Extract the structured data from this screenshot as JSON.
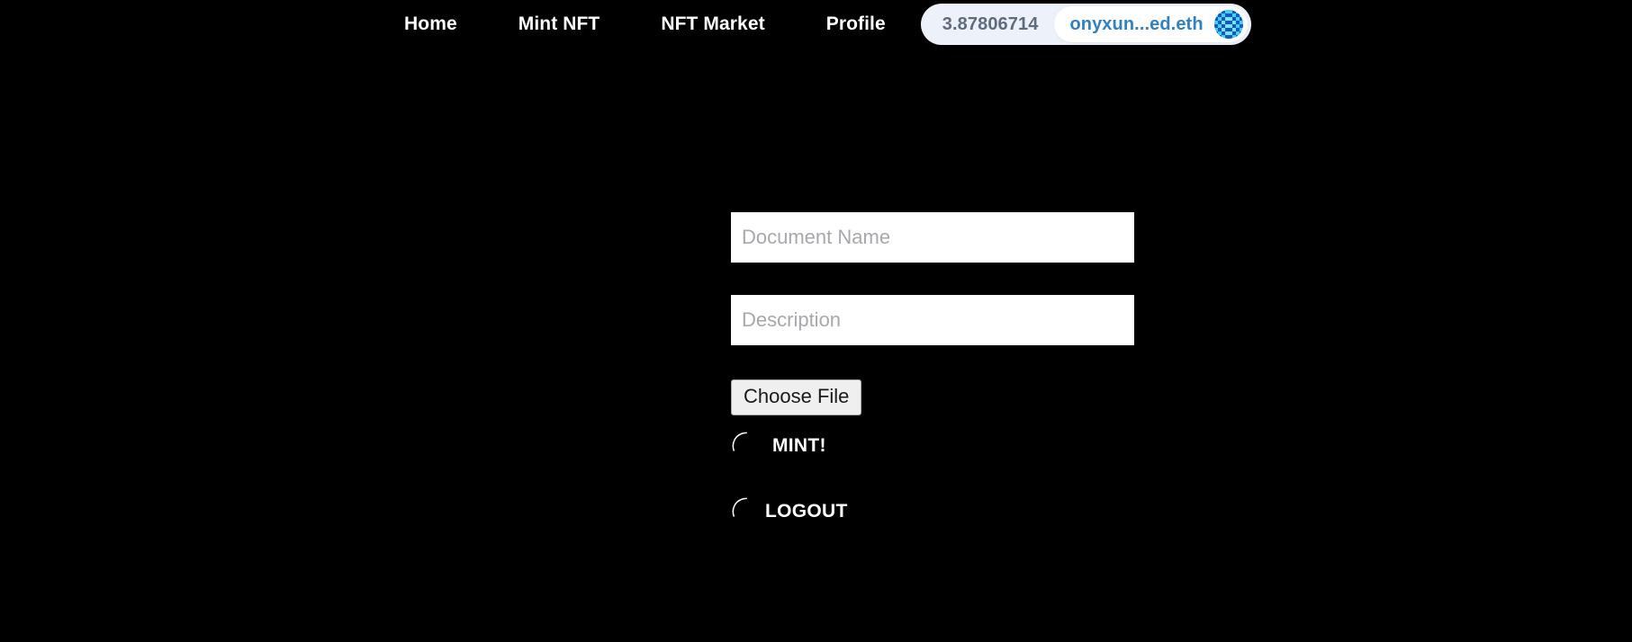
{
  "page": {
    "background_color": "#000000",
    "title": "Mint NFT"
  },
  "navbar": {
    "links": [
      {
        "label": "Home",
        "name": "nav-link-home"
      },
      {
        "label": "Mint NFT",
        "name": "nav-link-mint-nft"
      },
      {
        "label": "NFT Market",
        "name": "nav-link-nft-market"
      },
      {
        "label": "Profile",
        "name": "nav-link-profile"
      }
    ],
    "wallet": {
      "balance": "3.87806714",
      "ens_name": "onyxun...ed.eth",
      "avatar_icon": "blockies-identicon-avatar",
      "balance_color": "#5f6b80",
      "ens_color": "#2f81c2",
      "badge_background": "#edf1f9",
      "account_background": "#ffffff",
      "avatar_color": "#29c7e8"
    }
  },
  "form": {
    "document_name": {
      "placeholder": "Document Name",
      "value": ""
    },
    "description": {
      "placeholder": "Description",
      "value": ""
    },
    "choose_file_label": "Choose File",
    "mint_label": "MINT!",
    "logout_label": "LOGOUT",
    "spinner_icon": "loading-spinner-icon",
    "field_background": "#ffffff",
    "placeholder_color": "#a8a8ac",
    "file_button_background": "#efefef"
  }
}
